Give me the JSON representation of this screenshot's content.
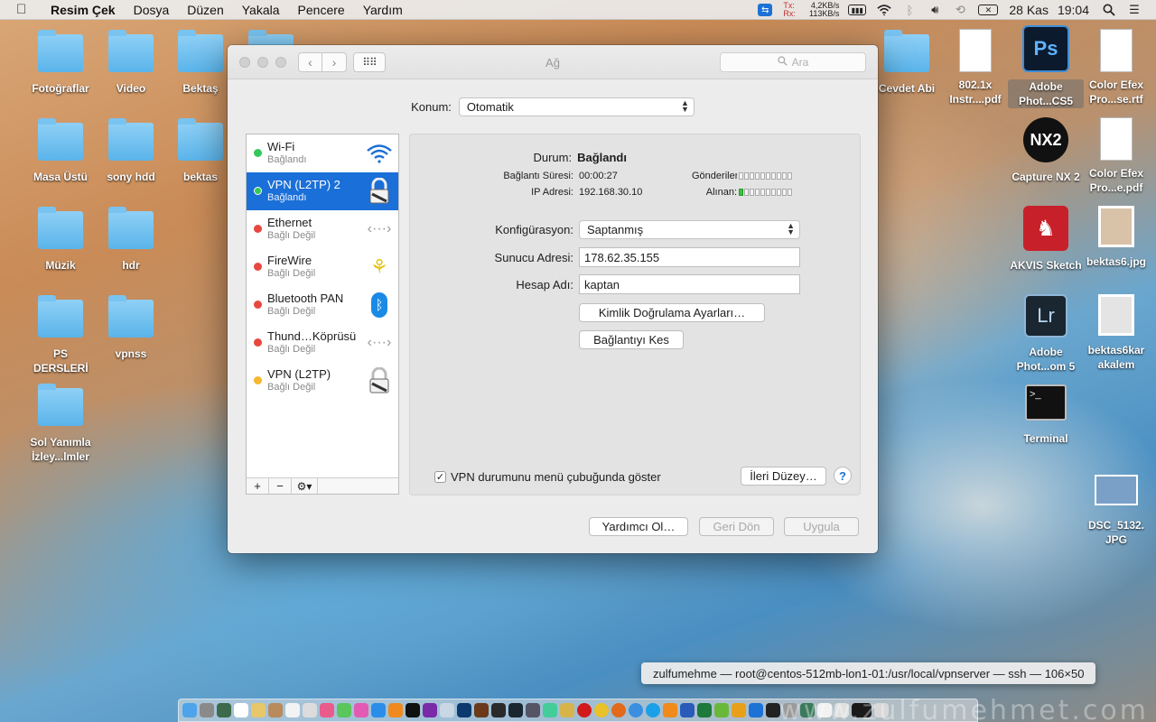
{
  "menubar": {
    "apple": "",
    "items": [
      "Resim Çek",
      "Dosya",
      "Düzen",
      "Yakala",
      "Pencere",
      "Yardım"
    ],
    "net": {
      "tx_label": "Tx:",
      "tx_value": "4,2KB/s",
      "rx_label": "Rx:",
      "rx_value": "113KB/s"
    },
    "date": "28 Kas",
    "time": "19:04"
  },
  "desktop_left": [
    {
      "label": "Fotoğraflar"
    },
    {
      "label": "Video"
    },
    {
      "label": "Bektaş"
    },
    {
      "label": "Masa Üstü"
    },
    {
      "label": "sony hdd"
    },
    {
      "label": "bektas"
    },
    {
      "label": "Müzik"
    },
    {
      "label": "hdr"
    },
    {
      "label": "PS DERSLERİ"
    },
    {
      "label": "vpnss"
    },
    {
      "label": "Sol Yanımla İzley...lmler"
    }
  ],
  "desktop_right": [
    {
      "label": "Cevdet Abi"
    },
    {
      "label": "802.1x Instr....pdf"
    },
    {
      "label": "Adobe Phot...CS5"
    },
    {
      "label": "Color Efex Pro...se.rtf"
    },
    {
      "label": "Capture NX 2"
    },
    {
      "label": "Color Efex Pro...e.pdf"
    },
    {
      "label": "AKVIS Sketch"
    },
    {
      "label": "bektas6.jpg"
    },
    {
      "label": "Adobe Phot...om 5"
    },
    {
      "label": "bektas6kar akalem"
    },
    {
      "label": "Terminal"
    },
    {
      "label": "DSC_5132. JPG"
    }
  ],
  "window": {
    "title": "Ağ",
    "search_placeholder": "Ara",
    "location_label": "Konum:",
    "location_value": "Otomatik",
    "services": [
      {
        "name": "Wi-Fi",
        "status": "Bağlandı",
        "dot": "#34c759",
        "icon": "wifi-icon"
      },
      {
        "name": "VPN (L2TP) 2",
        "status": "Bağlandı",
        "dot": "#34c759",
        "icon": "lock-icon"
      },
      {
        "name": "Ethernet",
        "status": "Bağlı Değil",
        "dot": "#e9473f",
        "icon": "ethernet-icon"
      },
      {
        "name": "FireWire",
        "status": "Bağlı Değil",
        "dot": "#e9473f",
        "icon": "firewire-icon"
      },
      {
        "name": "Bluetooth PAN",
        "status": "Bağlı Değil",
        "dot": "#e9473f",
        "icon": "bluetooth-icon"
      },
      {
        "name": "Thund…Köprüsü",
        "status": "Bağlı Değil",
        "dot": "#e9473f",
        "icon": "thunderbolt-icon"
      },
      {
        "name": "VPN (L2TP)",
        "status": "Bağlı Değil",
        "dot": "#f5b82e",
        "icon": "lock-icon"
      }
    ],
    "detail": {
      "status_label": "Durum:",
      "status_value": "Bağlandı",
      "duration_label": "Bağlantı Süresi:",
      "duration_value": "00:00:27",
      "ip_label": "IP Adresi:",
      "ip_value": "192.168.30.10",
      "sent_label": "Gönderilen:",
      "received_label": "Alınan:",
      "config_label": "Konfigürasyon:",
      "config_value": "Saptanmış",
      "server_label": "Sunucu Adresi:",
      "server_value": "178.62.35.155",
      "account_label": "Hesap Adı:",
      "account_value": "kaptan",
      "auth_button": "Kimlik Doğrulama Ayarları…",
      "disconnect_button": "Bağlantıyı Kes",
      "show_vpn_label": "VPN durumunu menü çubuğunda göster",
      "advanced_button": "İleri Düzey…",
      "help": "?"
    },
    "footer": {
      "assist_button": "Yardımcı Ol…",
      "revert_button": "Geri Dön",
      "apply_button": "Uygula"
    }
  },
  "tooltip": "zulfumehme — root@centos-512mb-lon1-01:/usr/local/vpnserver — ssh — 106×50",
  "watermark": "www.zulfumehmet.com"
}
